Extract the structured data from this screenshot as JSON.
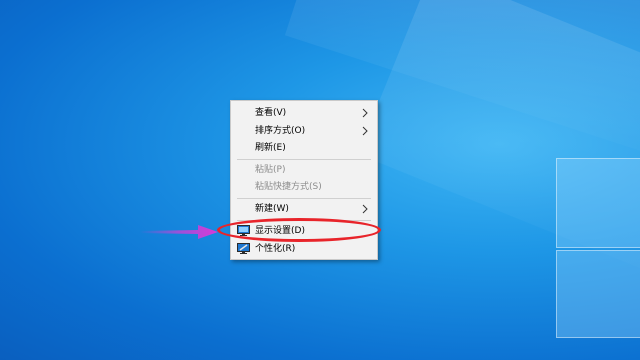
{
  "context_menu": {
    "items": [
      {
        "label": "查看(V)",
        "has_submenu": true,
        "enabled": true
      },
      {
        "label": "排序方式(O)",
        "has_submenu": true,
        "enabled": true
      },
      {
        "label": "刷新(E)",
        "has_submenu": false,
        "enabled": true
      },
      {
        "label": "粘贴(P)",
        "has_submenu": false,
        "enabled": false
      },
      {
        "label": "粘贴快捷方式(S)",
        "has_submenu": false,
        "enabled": false
      },
      {
        "label": "新建(W)",
        "has_submenu": true,
        "enabled": true
      },
      {
        "label": "显示设置(D)",
        "has_submenu": false,
        "enabled": true,
        "icon": "display-icon"
      },
      {
        "label": "个性化(R)",
        "has_submenu": false,
        "enabled": true,
        "icon": "personalize-icon"
      }
    ]
  },
  "annotation": {
    "highlight_color": "#e8242a",
    "arrow_color": "#d63bd8",
    "highlighted_item": "显示设置(D)"
  }
}
